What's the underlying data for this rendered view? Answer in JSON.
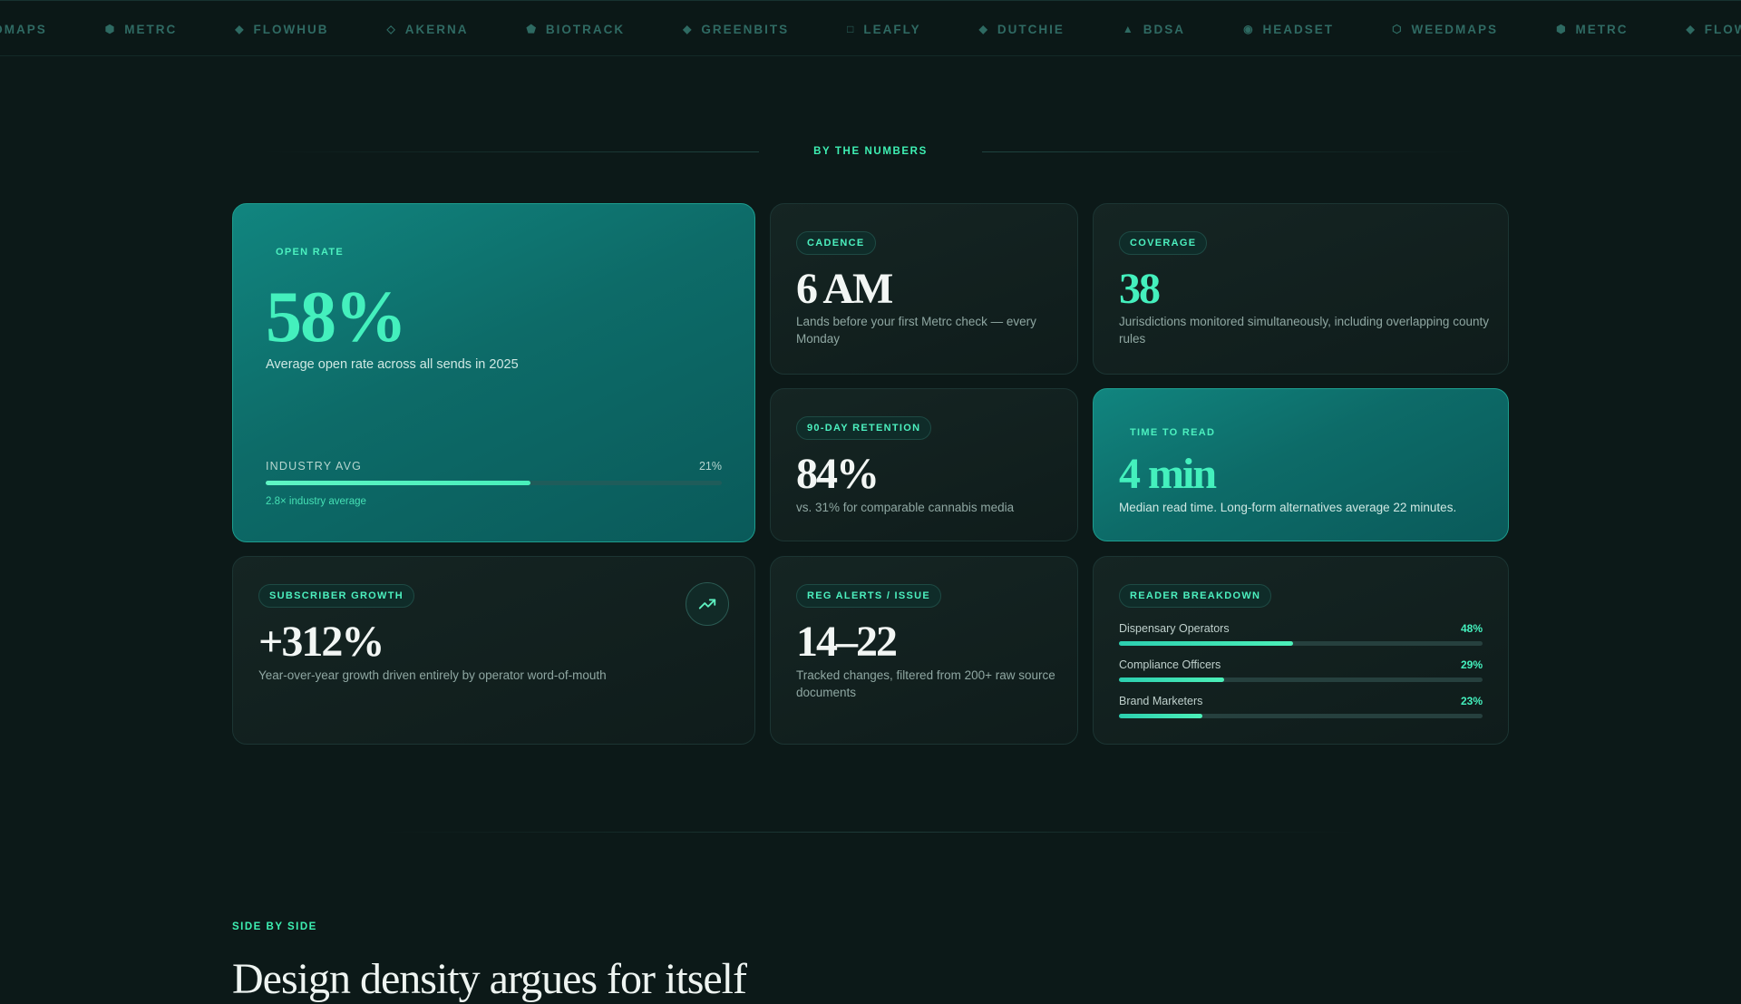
{
  "ticker": {
    "items": [
      {
        "label": "EDMAPS",
        "icon": ""
      },
      {
        "label": "METRC",
        "icon": "⬢"
      },
      {
        "label": "FLOWHUB",
        "icon": "◆"
      },
      {
        "label": "AKERNA",
        "icon": "◇"
      },
      {
        "label": "BIOTRACK",
        "icon": "⬟"
      },
      {
        "label": "GREENBITS",
        "icon": "◆"
      },
      {
        "label": "LEAFLY",
        "icon": "□"
      },
      {
        "label": "DUTCHIE",
        "icon": "◆"
      },
      {
        "label": "BDSA",
        "icon": "▲"
      },
      {
        "label": "HEADSET",
        "icon": "◉"
      },
      {
        "label": "WEEDMAPS",
        "icon": "⬡"
      },
      {
        "label": "METRC",
        "icon": "⬢"
      },
      {
        "label": "FLOWHUB",
        "icon": "◆"
      }
    ]
  },
  "numbers": {
    "section_label": "BY THE NUMBERS",
    "open_rate": {
      "pill": "OPEN RATE",
      "value": "58%",
      "desc": "Average open rate across all sends in 2025",
      "industry_label": "INDUSTRY AVG",
      "industry_value": "21%",
      "bar_fraction": 0.58,
      "footnote": "2.8× industry average"
    },
    "cadence": {
      "pill": "CADENCE",
      "value": "6 AM",
      "desc": "Lands before your first Metrc check — every Monday"
    },
    "coverage": {
      "pill": "COVERAGE",
      "value": "38",
      "desc": "Jurisdictions monitored simultaneously, including overlapping county rules"
    },
    "retention": {
      "pill": "90-DAY RETENTION",
      "value": "84%",
      "desc": "vs. 31% for comparable cannabis media"
    },
    "time_to_read": {
      "pill": "TIME TO READ",
      "value": "4 min",
      "desc": "Median read time. Long-form alternatives average 22 minutes."
    },
    "growth": {
      "pill": "SUBSCRIBER GROWTH",
      "value": "+312%",
      "desc": "Year-over-year growth driven entirely by operator word-of-mouth",
      "icon": "trending-up-icon"
    },
    "reg_alerts": {
      "pill": "REG ALERTS / ISSUE",
      "value": "14–22",
      "desc": "Tracked changes, filtered from 200+ raw source documents"
    },
    "breakdown": {
      "pill": "READER BREAKDOWN",
      "rows": [
        {
          "label": "Dispensary Operators",
          "value": "48%",
          "fraction": 0.48
        },
        {
          "label": "Compliance Officers",
          "value": "29%",
          "fraction": 0.29
        },
        {
          "label": "Brand Marketers",
          "value": "23%",
          "fraction": 0.23
        }
      ]
    }
  },
  "side_by_side": {
    "label": "SIDE BY SIDE",
    "heading": "Design density argues for itself"
  },
  "colors": {
    "accent": "#3ef0b3",
    "background": "#0c1918",
    "featured_card": "#0e716c"
  }
}
